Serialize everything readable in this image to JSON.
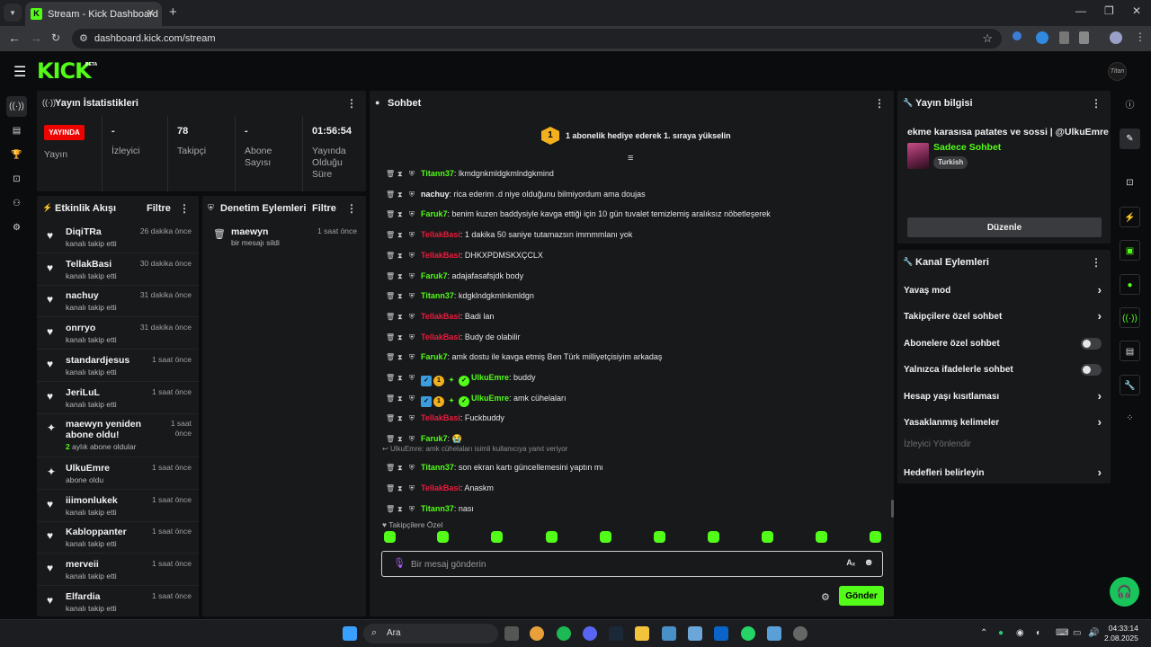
{
  "browser": {
    "tab_title": "Stream - Kick Dashboard",
    "url": "dashboard.kick.com/stream"
  },
  "app": {
    "logo": "KICK",
    "beta": "BETA"
  },
  "stats": {
    "title": "Yayın İstatistikleri",
    "live_badge": "YAYINDA",
    "live_label": "Yayın",
    "viewers_value": "-",
    "viewers_label": "İzleyici",
    "followers_value": "78",
    "followers_label": "Takipçi",
    "subs_value": "-",
    "subs_label": "Abone Sayısı",
    "duration_value": "01:56:54",
    "duration_label": "Yayında Olduğu Süre"
  },
  "activity": {
    "title": "Etkinlik Akışı",
    "filter": "Filtre",
    "items": [
      {
        "name": "DiqiTRa",
        "desc": "kanalı takip etti",
        "time": "26 dakika önce"
      },
      {
        "name": "TellakBasi",
        "desc": "kanalı takip etti",
        "time": "30 dakika önce"
      },
      {
        "name": "nachuy",
        "desc": "kanalı takip etti",
        "time": "31 dakika önce"
      },
      {
        "name": "onrryo",
        "desc": "kanalı takip etti",
        "time": "31 dakika önce"
      },
      {
        "name": "standardjesus",
        "desc": "kanalı takip etti",
        "time": "1 saat önce"
      },
      {
        "name": "JeriLuL",
        "desc": "kanalı takip etti",
        "time": "1 saat önce"
      },
      {
        "name": "maewyn yeniden abone oldu!",
        "desc_count": "2",
        "desc": "aylık abone oldular",
        "time": "1 saat önce"
      },
      {
        "name": "UlkuEmre",
        "desc": "abone oldu",
        "time": "1 saat önce"
      },
      {
        "name": "iiimonlukek",
        "desc": "kanalı takip etti",
        "time": "1 saat önce"
      },
      {
        "name": "Kabloppanter",
        "desc": "kanalı takip etti",
        "time": "1 saat önce"
      },
      {
        "name": "merveii",
        "desc": "kanalı takip etti",
        "time": "1 saat önce"
      },
      {
        "name": "Elfardia",
        "desc": "kanalı takip etti",
        "time": "1 saat önce"
      }
    ]
  },
  "moderation": {
    "title": "Denetim Eylemleri",
    "filter": "Filtre",
    "items": [
      {
        "name": "maewyn",
        "desc": "bir mesajı sildi",
        "time": "1 saat önce"
      }
    ]
  },
  "chat": {
    "title": "Sohbet",
    "pinned_rank": "1",
    "pinned_text": "1 abonelik hediye ederek 1. sıraya yükselin",
    "messages": [
      {
        "user": "Titann37",
        "color": "g",
        "text": ": lkmdgnkmldgkmlndgkmind"
      },
      {
        "user": "nachuy",
        "color": "w",
        "text": ": rica ederim .d niye olduğunu bilmiyordum ama doujas"
      },
      {
        "user": "Faruk7",
        "color": "g",
        "text": ": benim kuzen baddysiyle kavga ettiği için 10 gün tuvalet temizlemiş aralıksız nöbetleşerek"
      },
      {
        "user": "TellakBasi",
        "color": "r",
        "text": ": 1 dakika 50 saniye tutamazsın immmmlanı yok"
      },
      {
        "user": "TellakBasi",
        "color": "r",
        "text": ": DHKXPDMSKXÇCLX"
      },
      {
        "user": "Faruk7",
        "color": "g",
        "text": ": adajafasafsjdk body"
      },
      {
        "user": "Titann37",
        "color": "g",
        "text": ": kdgklndgkmlnkmldgn"
      },
      {
        "user": "TellakBasi",
        "color": "r",
        "text": ": Badi lan"
      },
      {
        "user": "TellakBasi",
        "color": "r",
        "text": ": Budy de olabilir"
      },
      {
        "user": "Faruk7",
        "color": "g",
        "text": ": amk dostu ile kavga etmiş Ben Türk milliyetçisiyim arkadaş"
      },
      {
        "user": "UlkuEmre",
        "color": "g",
        "text": ": buddy",
        "badges": true
      },
      {
        "user": "UlkuEmre",
        "color": "g",
        "text": ": amk cühelaları",
        "badges": true
      },
      {
        "user": "TellakBasi",
        "color": "r",
        "text": ": Fuckbuddy"
      },
      {
        "user": "Faruk7",
        "color": "g",
        "text": ": 😭"
      }
    ],
    "reply_note": "UlkuEmre: amk cühelaları isimli kullanıcıya yanıt veriyor",
    "messages2": [
      {
        "user": "Titann37",
        "color": "g",
        "text": ": son ekran kartı güncellemesini yaptın mı"
      },
      {
        "user": "TellakBasi",
        "color": "r",
        "text": ": Anaskm"
      },
      {
        "user": "Titann37",
        "color": "g",
        "text": ": nası"
      }
    ],
    "follow_only": "Takipçilere Özel",
    "placeholder": "Bir mesaj gönderin",
    "send": "Gönder"
  },
  "stream_info": {
    "title": "Yayın bilgisi",
    "stream_title": "ekme karasısa patates ve sossi | @UlkuEmre",
    "category": "Sadece Sohbet",
    "tag": "Turkish",
    "edit": "Düzenle"
  },
  "channel_actions": {
    "title": "Kanal Eylemleri",
    "items": [
      {
        "label": "Yavaş mod",
        "type": "chevron"
      },
      {
        "label": "Takipçilere özel sohbet",
        "type": "chevron"
      },
      {
        "label": "Abonelere özel sohbet",
        "type": "toggle"
      },
      {
        "label": "Yalnızca ifadelerle sohbet",
        "type": "toggle"
      },
      {
        "label": "Hesap yaşı kısıtlaması",
        "type": "chevron"
      },
      {
        "label": "Yasaklanmış kelimeler",
        "type": "chevron"
      },
      {
        "label": "İzleyici Yönlendir",
        "type": "disabled"
      },
      {
        "label": "Hedefleri belirleyin",
        "type": "chevron"
      }
    ]
  },
  "taskbar": {
    "search": "Ara",
    "time": "04:33:14",
    "date": "2.08.2025"
  },
  "colors": {
    "accent": "#53fc18",
    "live": "#eb0400",
    "red_user": "#eb1b3d"
  }
}
